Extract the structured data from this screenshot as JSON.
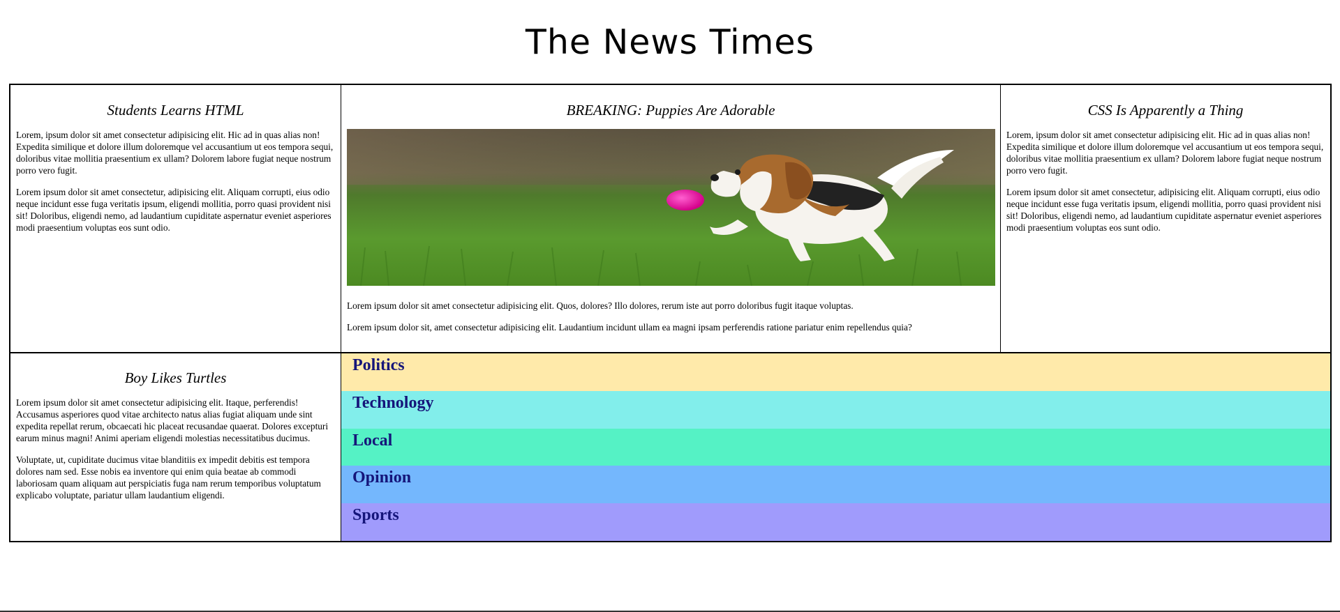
{
  "site": {
    "title": "The News Times"
  },
  "articles": {
    "students": {
      "title": "Students Learns HTML",
      "paragraphs": [
        "Lorem, ipsum dolor sit amet consectetur adipisicing elit. Hic ad in quas alias non! Expedita similique et dolore illum doloremque vel accusantium ut eos tempora sequi, doloribus vitae mollitia praesentium ex ullam? Dolorem labore fugiat neque nostrum porro vero fugit.",
        "Lorem ipsum dolor sit amet consectetur, adipisicing elit. Aliquam corrupti, eius odio neque incidunt esse fuga veritatis ipsum, eligendi mollitia, porro quasi provident nisi sit! Doloribus, eligendi nemo, ad laudantium cupiditate aspernatur eveniet asperiores modi praesentium voluptas eos sunt odio."
      ]
    },
    "breaking": {
      "title": "BREAKING: Puppies Are Adorable",
      "image_subject": "beagle-puppy-with-pink-ball",
      "paragraphs": [
        "Lorem ipsum dolor sit amet consectetur adipisicing elit. Quos, dolores? Illo dolores, rerum iste aut porro doloribus fugit itaque voluptas.",
        "Lorem ipsum dolor sit, amet consectetur adipisicing elit. Laudantium incidunt ullam ea magni ipsam perferendis ratione pariatur enim repellendus quia?"
      ]
    },
    "css": {
      "title": "CSS Is Apparently a Thing",
      "paragraphs": [
        "Lorem, ipsum dolor sit amet consectetur adipisicing elit. Hic ad in quas alias non! Expedita similique et dolore illum doloremque vel accusantium ut eos tempora sequi, doloribus vitae mollitia praesentium ex ullam? Dolorem labore fugiat neque nostrum porro vero fugit.",
        "Lorem ipsum dolor sit amet consectetur, adipisicing elit. Aliquam corrupti, eius odio neque incidunt esse fuga veritatis ipsum, eligendi mollitia, porro quasi provident nisi sit! Doloribus, eligendi nemo, ad laudantium cupiditate aspernatur eveniet asperiores modi praesentium voluptas eos sunt odio."
      ]
    },
    "turtles": {
      "title": "Boy Likes Turtles",
      "paragraphs": [
        "Lorem ipsum dolor sit amet consectetur adipisicing elit. Itaque, perferendis! Accusamus asperiores quod vitae architecto natus alias fugiat aliquam unde sint expedita repellat rerum, obcaecati hic placeat recusandae quaerat. Dolores excepturi earum minus magni! Animi aperiam eligendi molestias necessitatibus ducimus.",
        "Voluptate, ut, cupiditate ducimus vitae blanditiis ex impedit debitis est tempora dolores nam sed. Esse nobis ea inventore qui enim quia beatae ab commodi laboriosam quam aliquam aut perspiciatis fuga nam rerum temporibus voluptatum explicabo voluptate, pariatur ullam laudantium eligendi."
      ]
    }
  },
  "categories": [
    {
      "label": "Politics",
      "color": "#ffeaaa"
    },
    {
      "label": "Technology",
      "color": "#82eeeb"
    },
    {
      "label": "Local",
      "color": "#55f2c5"
    },
    {
      "label": "Opinion",
      "color": "#74b7fd"
    },
    {
      "label": "Sports",
      "color": "#a09bfc"
    }
  ],
  "colors": {
    "category_text": "#15157a",
    "border": "#000000"
  }
}
